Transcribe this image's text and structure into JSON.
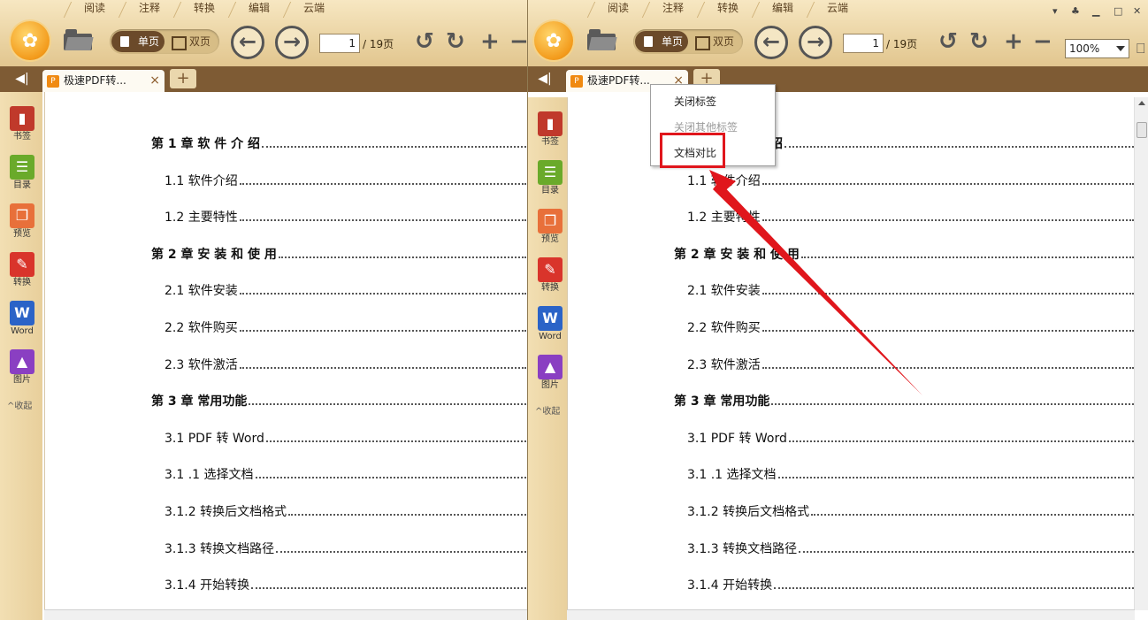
{
  "menu_tabs": [
    "阅读",
    "注释",
    "转换",
    "编辑",
    "云端"
  ],
  "toolbar": {
    "single_page_label": "单页",
    "double_page_label": "双页",
    "page_current": "1",
    "page_total": "/ 19页",
    "zoom": "100%"
  },
  "tab": {
    "title": "极速PDF转...",
    "title_right": "极速PDF转...",
    "add": "+"
  },
  "sidebar": {
    "items": [
      {
        "label": "书签",
        "icon": "bookmark-icon",
        "color": "#c0392b"
      },
      {
        "label": "目录",
        "icon": "toc-icon",
        "color": "#6aaa2a"
      },
      {
        "label": "预览",
        "icon": "preview-icon",
        "color": "#e8703a"
      },
      {
        "label": "转换",
        "icon": "pdf-convert-icon",
        "color": "#d9342b"
      },
      {
        "label": "Word",
        "icon": "word-icon",
        "color": "#2b63c7"
      },
      {
        "label": "图片",
        "icon": "image-icon",
        "color": "#8a3fc2"
      }
    ],
    "collapse_label": "^收起"
  },
  "toc": [
    {
      "text": "第 1 章  软 件 介 绍",
      "level": 0
    },
    {
      "text": "1.1 软件介绍",
      "level": 1
    },
    {
      "text": "1.2 主要特性",
      "level": 1
    },
    {
      "text": "第 2 章    安 装 和 使 用",
      "level": 0
    },
    {
      "text": "2.1 软件安装",
      "level": 1
    },
    {
      "text": "2.2 软件购买",
      "level": 1
    },
    {
      "text": "2.3 软件激活",
      "level": 1
    },
    {
      "text": "第 3 章  常用功能",
      "level": 0
    },
    {
      "text": "3.1  PDF 转 Word",
      "level": 1
    },
    {
      "text": "3.1 .1 选择文档",
      "level": 1
    },
    {
      "text": "3.1.2 转换后文档格式",
      "level": 1
    },
    {
      "text": "3.1.3 转换文档路径",
      "level": 1
    },
    {
      "text": "3.1.4  开始转换",
      "level": 1
    }
  ],
  "context_menu": {
    "items": [
      {
        "label": "关闭标签",
        "disabled": false
      },
      {
        "label": "关闭其他标签",
        "disabled": true
      },
      {
        "label": "文档对比",
        "disabled": false
      }
    ]
  },
  "colors": {
    "highlight": "#e0161c",
    "annotation_arrow": "#e0161c",
    "tab_bar": "#7e5b34"
  }
}
